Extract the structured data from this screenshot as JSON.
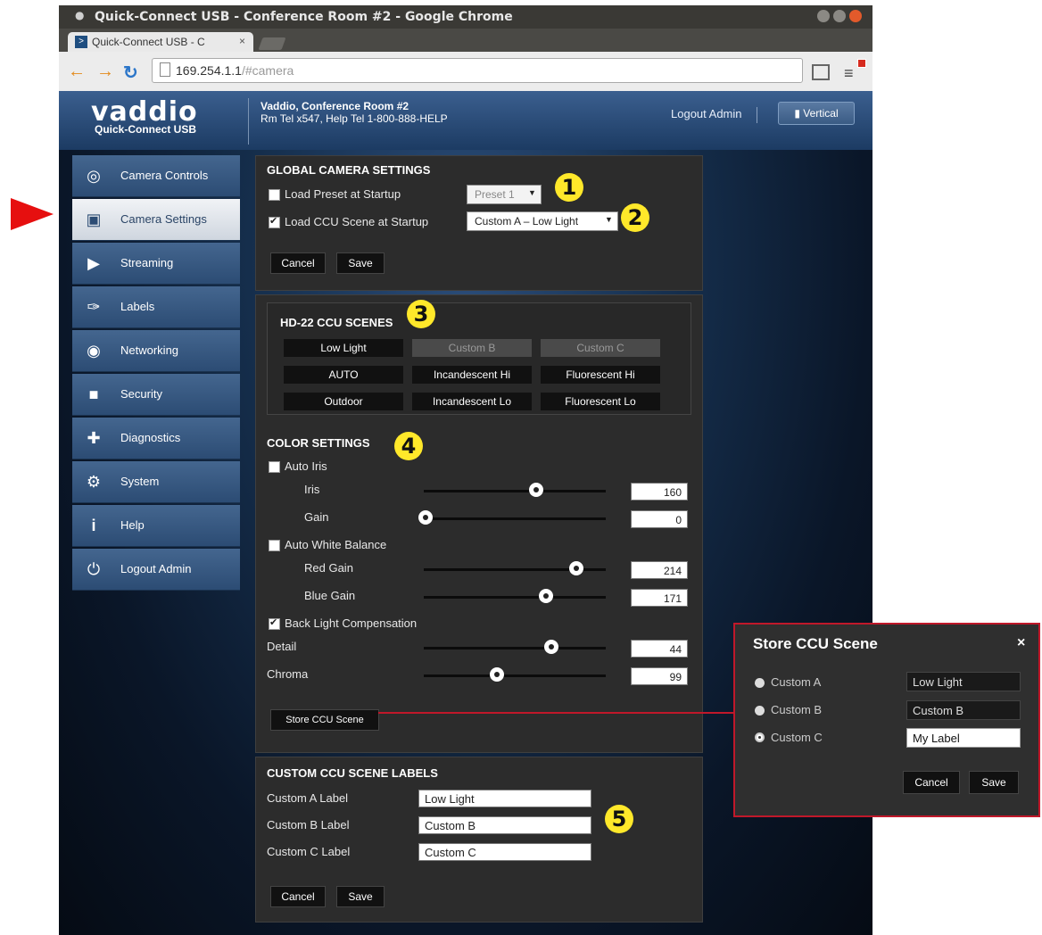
{
  "window": {
    "title": "Quick-Connect USB - Conference Room #2 - Google Chrome",
    "tab_label": "Quick-Connect USB - C",
    "tab_close": "×",
    "url_host": "169.254.1.1",
    "url_path": "/#camera"
  },
  "header": {
    "logo": "vaddio",
    "logo_sub": "Quick-Connect USB",
    "title": "Vaddio, Conference Room #2",
    "subtitle": "Rm Tel x547, Help Tel 1-800-888-HELP",
    "logout": "Logout Admin",
    "vertical_btn": "Vertical"
  },
  "sidebar": {
    "items": [
      {
        "label": "Camera Controls",
        "icon": "camera-controls-icon"
      },
      {
        "label": "Camera Settings",
        "icon": "camera-settings-icon",
        "active": true
      },
      {
        "label": "Streaming",
        "icon": "streaming-icon"
      },
      {
        "label": "Labels",
        "icon": "labels-icon"
      },
      {
        "label": "Networking",
        "icon": "networking-icon"
      },
      {
        "label": "Security",
        "icon": "security-icon"
      },
      {
        "label": "Diagnostics",
        "icon": "diagnostics-icon"
      },
      {
        "label": "System",
        "icon": "system-icon"
      },
      {
        "label": "Help",
        "icon": "help-icon"
      },
      {
        "label": "Logout Admin",
        "icon": "logout-icon"
      }
    ]
  },
  "global": {
    "title": "GLOBAL CAMERA SETTINGS",
    "load_preset_label": "Load Preset at Startup",
    "load_preset_checked": false,
    "preset_value": "Preset 1",
    "load_ccu_label": "Load CCU Scene at Startup",
    "load_ccu_checked": true,
    "ccu_value": "Custom A – Low Light",
    "cancel": "Cancel",
    "save": "Save"
  },
  "scenes": {
    "title": "HD-22 CCU SCENES",
    "buttons": [
      "Low Light",
      "Custom B",
      "Custom C",
      "AUTO",
      "Incandescent Hi",
      "Fluorescent Hi",
      "Outdoor",
      "Incandescent Lo",
      "Fluorescent Lo"
    ]
  },
  "color": {
    "title": "COLOR SETTINGS",
    "auto_iris": "Auto Iris",
    "auto_iris_checked": false,
    "iris_label": "Iris",
    "iris_value": "160",
    "gain_label": "Gain",
    "gain_value": "0",
    "auto_wb": "Auto White Balance",
    "auto_wb_checked": false,
    "red_label": "Red Gain",
    "red_value": "214",
    "blue_label": "Blue Gain",
    "blue_value": "171",
    "blc": "Back Light Compensation",
    "blc_checked": true,
    "detail_label": "Detail",
    "detail_value": "44",
    "chroma_label": "Chroma",
    "chroma_value": "99",
    "store_btn": "Store CCU Scene"
  },
  "custom_labels": {
    "title": "CUSTOM CCU SCENE LABELS",
    "a_label": "Custom A Label",
    "a_value": "Low Light",
    "b_label": "Custom B Label",
    "b_value": "Custom B",
    "c_label": "Custom C Label",
    "c_value": "Custom C",
    "cancel": "Cancel",
    "save": "Save"
  },
  "modal": {
    "title": "Store CCU Scene",
    "close": "×",
    "options": [
      "Custom A",
      "Custom B",
      "Custom C"
    ],
    "labels": [
      "Low Light",
      "Custom B",
      "My Label"
    ],
    "cancel": "Cancel",
    "save": "Save"
  },
  "callouts": [
    "1",
    "2",
    "3",
    "4",
    "5"
  ],
  "colors": {
    "callout": "#ffe82a",
    "highlight": "#c0182a",
    "pointer": "#e60f0f"
  }
}
